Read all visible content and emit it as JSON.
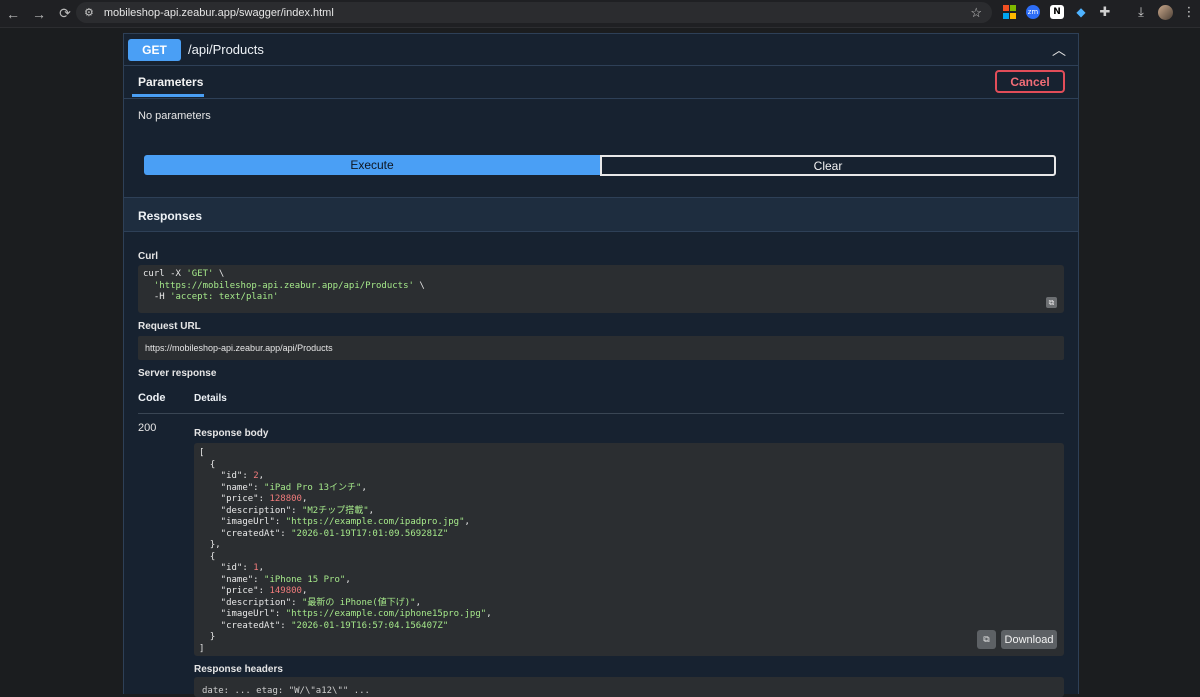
{
  "browser": {
    "url": "mobileshop-api.zeabur.app/swagger/index.html",
    "extensions": [
      "microsoft-icon",
      "zm-icon",
      "notion-icon",
      "gem-icon"
    ]
  },
  "operation": {
    "method": "GET",
    "path": "/api/Products"
  },
  "parameters": {
    "tab_label": "Parameters",
    "cancel_label": "Cancel",
    "empty_text": "No parameters"
  },
  "actions": {
    "execute_label": "Execute",
    "clear_label": "Clear"
  },
  "responses": {
    "title": "Responses",
    "curl_label": "Curl",
    "curl_lines": [
      "curl -X 'GET' \\",
      "  'https://mobileshop-api.zeabur.app/api/Products' \\",
      "  -H 'accept: text/plain'"
    ],
    "request_url_label": "Request URL",
    "request_url": "https://mobileshop-api.zeabur.app/api/Products",
    "server_response_label": "Server response",
    "code_header": "Code",
    "details_header": "Details",
    "status_code": "200",
    "response_body_label": "Response body",
    "response_body": [
      {
        "id": 2,
        "name": "iPad Pro 13インチ",
        "price": 128800,
        "description": "M2チップ搭載",
        "imageUrl": "https://example.com/ipadpro.jpg",
        "createdAt": "2026-01-19T17:01:09.569281Z"
      },
      {
        "id": 1,
        "name": "iPhone 15 Pro",
        "price": 149800,
        "description": "最新の iPhone(値下げ)",
        "imageUrl": "https://example.com/iphone15pro.jpg",
        "createdAt": "2026-01-19T16:57:04.156407Z"
      }
    ],
    "download_label": "Download",
    "response_headers_label": "Response headers",
    "response_headers_preview": "date: ... etag: \"W/\\\"a12\\\"\" ..."
  }
}
